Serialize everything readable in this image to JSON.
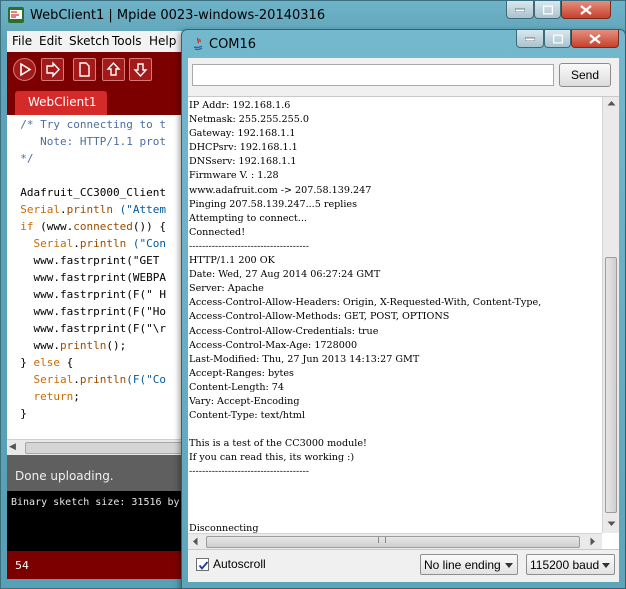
{
  "ide": {
    "title": "WebClient1 | Mpide 0023-windows-20140316",
    "menu": [
      "File",
      "Edit",
      "Sketch",
      "Tools",
      "Help"
    ],
    "tab": "WebClient1",
    "code_lines": [
      [
        {
          "t": "  /* Try connecting to t",
          "c": "comment"
        }
      ],
      [
        {
          "t": "     Note: HTTP/1.1 prot",
          "c": "comment"
        }
      ],
      [
        {
          "t": "  */",
          "c": "comment"
        }
      ],
      [
        {
          "t": "",
          "c": ""
        }
      ],
      [
        {
          "t": "  Adafruit_CC3000_Client",
          "c": ""
        }
      ],
      [
        {
          "t": "  ",
          "c": ""
        },
        {
          "t": "Serial",
          "c": "kw"
        },
        {
          "t": ".",
          "c": ""
        },
        {
          "t": "println",
          "c": "fn"
        },
        {
          "t": " (\"Attem",
          "c": "str"
        }
      ],
      [
        {
          "t": "  ",
          "c": ""
        },
        {
          "t": "if",
          "c": "kw"
        },
        {
          "t": " (www.",
          "c": ""
        },
        {
          "t": "connected",
          "c": "fn"
        },
        {
          "t": "()) {",
          "c": ""
        }
      ],
      [
        {
          "t": "    ",
          "c": ""
        },
        {
          "t": "Serial",
          "c": "kw"
        },
        {
          "t": ".",
          "c": ""
        },
        {
          "t": "println",
          "c": "fn"
        },
        {
          "t": " (\"Con",
          "c": "str"
        }
      ],
      [
        {
          "t": "    www.fastrprint(\"GET ",
          "c": ""
        }
      ],
      [
        {
          "t": "    www.fastrprint(WEBPA",
          "c": ""
        }
      ],
      [
        {
          "t": "    www.fastrprint(F(\" H",
          "c": ""
        }
      ],
      [
        {
          "t": "    www.fastrprint(F(\"Ho",
          "c": ""
        }
      ],
      [
        {
          "t": "    www.fastrprint(F(\"\\r",
          "c": ""
        }
      ],
      [
        {
          "t": "    www.",
          "c": ""
        },
        {
          "t": "println",
          "c": "fn"
        },
        {
          "t": "();",
          "c": ""
        }
      ],
      [
        {
          "t": "  } ",
          "c": ""
        },
        {
          "t": "else",
          "c": "kw"
        },
        {
          "t": " {",
          "c": ""
        }
      ],
      [
        {
          "t": "    ",
          "c": ""
        },
        {
          "t": "Serial",
          "c": "kw"
        },
        {
          "t": ".",
          "c": ""
        },
        {
          "t": "println",
          "c": "fn"
        },
        {
          "t": "(F(\"Co",
          "c": "str"
        }
      ],
      [
        {
          "t": "    ",
          "c": ""
        },
        {
          "t": "return",
          "c": "kw"
        },
        {
          "t": ";",
          "c": ""
        }
      ],
      [
        {
          "t": "  }",
          "c": ""
        }
      ]
    ],
    "status": "Done uploading.",
    "console": "Binary sketch size: 31516 by",
    "line_number": "54"
  },
  "serial": {
    "title": "COM16",
    "input_value": "",
    "send_label": "Send",
    "output_lines": [
      "IP Addr: 192.168.1.6",
      "Netmask: 255.255.255.0",
      "Gateway: 192.168.1.1",
      "DHCPsrv: 192.168.1.1",
      "DNSserv: 192.168.1.1",
      "Firmware V. : 1.28",
      "www.adafruit.com -> 207.58.139.247",
      "Pinging 207.58.139.247...5 replies",
      "Attempting to connect...",
      "Connected!",
      "-------------------------------------",
      "HTTP/1.1 200 OK",
      "Date: Wed, 27 Aug 2014 06:27:24 GMT",
      "Server: Apache",
      "Access-Control-Allow-Headers: Origin, X-Requested-With, Content-Type,",
      "Access-Control-Allow-Methods: GET, POST, OPTIONS",
      "Access-Control-Allow-Credentials: true",
      "Access-Control-Max-Age: 1728000",
      "Last-Modified: Thu, 27 Jun 2013 14:13:27 GMT",
      "Accept-Ranges: bytes",
      "Content-Length: 74",
      "Vary: Accept-Encoding",
      "Content-Type: text/html",
      "",
      "This is a test of the CC3000 module!",
      "If you can read this, its working :)",
      "-------------------------------------",
      "",
      "",
      "",
      "Disconnecting"
    ],
    "autoscroll_label": "Autoscroll",
    "autoscroll_checked": true,
    "line_ending": "No line ending",
    "baud": "115200 baud"
  }
}
